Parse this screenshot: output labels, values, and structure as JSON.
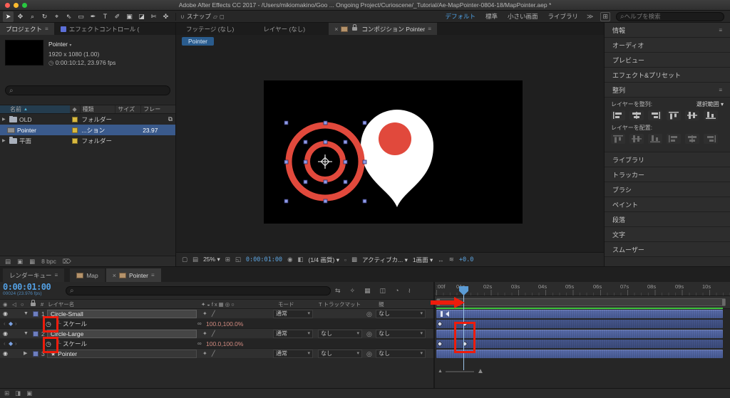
{
  "colors": {
    "annotation_red": "#ee1c0c",
    "accent_blue": "#4fa3e8",
    "selection_blue": "#3a5a8c",
    "layer_bar_blue": "#4a63a6",
    "target_red": "#e1493c",
    "label_yellow": "#d8b83f",
    "cache_green": "#3ec43e"
  },
  "titlebar": {
    "title": "Adobe After Effects CC 2017 - /Users/mikiomakino/Goo ... Ongoing Project/Curioscene/_Tutorial/Ae-MapPointer-0804-18/MapPointer.aep *"
  },
  "toolbar": {
    "tools": [
      {
        "name": "selection-tool",
        "glyph": "➤"
      },
      {
        "name": "hand-tool",
        "glyph": "✥"
      },
      {
        "name": "zoom-tool",
        "glyph": "⌕"
      },
      {
        "name": "rotation-tool",
        "glyph": "↻"
      },
      {
        "name": "camera-tool",
        "glyph": "⌖"
      },
      {
        "name": "pan-behind-tool",
        "glyph": "⇖"
      },
      {
        "name": "shape-tool",
        "glyph": "▭"
      },
      {
        "name": "pen-tool",
        "glyph": "✒"
      },
      {
        "name": "type-tool",
        "glyph": "T"
      },
      {
        "name": "brush-tool",
        "glyph": "✐"
      },
      {
        "name": "clone-stamp-tool",
        "glyph": "▣"
      },
      {
        "name": "eraser-tool",
        "glyph": "◪"
      },
      {
        "name": "roto-brush-tool",
        "glyph": "✄"
      },
      {
        "name": "puppet-pin-tool",
        "glyph": "✜"
      }
    ],
    "snap_label": "スナップ",
    "workspaces": [
      "デフォルト",
      "標準",
      "小さい画面",
      "ライブラリ"
    ],
    "overflow": "≫",
    "search_placeholder": "ヘルプを検索"
  },
  "project": {
    "tab_project": "プロジェクト",
    "tab_effect_controls": "エフェクトコントロール (",
    "comp_name": "Pointer",
    "comp_size": "1920 x 1080 (1.00)",
    "comp_duration": "0:00:10:12, 23.976 fps",
    "columns": {
      "name": "名前",
      "type": "種類",
      "size": "サイズ",
      "fps": "フレー"
    },
    "rows": [
      {
        "name": "OLD",
        "type": "フォルダー",
        "fps": ""
      },
      {
        "name": "Pointer",
        "type": "...ション",
        "fps": "23.97"
      },
      {
        "name": "平面",
        "type": "フォルダー",
        "fps": ""
      }
    ],
    "bpc": "8 bpc"
  },
  "comp": {
    "tab_footage": "フッテージ (なし)",
    "tab_layer": "レイヤー (なし)",
    "tab_comp": "コンポジション Pointer",
    "nav_tab": "Pointer",
    "footer": {
      "zoom": "25%",
      "timecode": "0:00:01:00",
      "quality": "(1/4 画質)",
      "view": "アクティブカ...",
      "layout": "1画面",
      "exposure": "+0.0"
    },
    "footer_icons": [
      {
        "name": "always-preview",
        "glyph": "▢"
      },
      {
        "name": "main-monitor",
        "glyph": "▤"
      },
      {
        "name": "grid-guides",
        "glyph": "⊞"
      },
      {
        "name": "mask-visibility",
        "glyph": "◱"
      },
      {
        "name": "snapshot",
        "glyph": "◉"
      },
      {
        "name": "show-channel",
        "glyph": "◧"
      },
      {
        "name": "region-of-interest",
        "glyph": "▫"
      },
      {
        "name": "transparency-grid",
        "glyph": "▩"
      },
      {
        "name": "pixel-aspect",
        "glyph": "↔"
      },
      {
        "name": "fast-previews",
        "glyph": "≋"
      }
    ]
  },
  "sidebar": {
    "items": [
      "情報",
      "オーディオ",
      "プレビュー",
      "エフェクト&プリセット",
      "整列",
      "ライブラリ",
      "トラッカー",
      "ブラシ",
      "ペイント",
      "段落",
      "文字",
      "スムーザー"
    ],
    "align": {
      "align_label": "レイヤーを整列:",
      "align_value": "選択範囲",
      "distribute_label": "レイヤーを配置:"
    }
  },
  "timeline": {
    "tab_render_queue": "レンダーキュー",
    "tab_map": "Map",
    "tab_pointer": "Pointer",
    "timecode": "0:00:01:00",
    "frame_info": "00024 (23.976 fps)",
    "columns": {
      "layer_name": "レイヤー名",
      "mode": "モード",
      "matte": "T トラックマット",
      "parent": "親"
    },
    "topbar_icons": [
      {
        "name": "comp-mini-flowchart",
        "glyph": "⇆"
      },
      {
        "name": "draft-3d",
        "glyph": "✧"
      },
      {
        "name": "hide-shy-layers",
        "glyph": "▦"
      },
      {
        "name": "frame-blend",
        "glyph": "◫"
      },
      {
        "name": "motion-blur",
        "glyph": "◔"
      },
      {
        "name": "graph-editor",
        "glyph": "≀"
      }
    ],
    "switch_header": "✦◒fx▦◎○",
    "layers": [
      {
        "num": "1",
        "name": "Circle-Small",
        "mode": "通常",
        "matte": "",
        "parent": "なし"
      },
      {
        "num": "2",
        "name": "Circle-Large",
        "mode": "通常",
        "matte": "なし",
        "parent": "なし"
      },
      {
        "num": "3",
        "name": "Pointer",
        "mode": "通常",
        "matte": "なし",
        "parent": "なし"
      }
    ],
    "property_name": "スケール",
    "property_value": "100.0,100.0%",
    "ruler_labels": [
      ":00f",
      "01s",
      "02s",
      "03s",
      "04s",
      "05s",
      "06s",
      "07s",
      "08s",
      "09s",
      "10s"
    ]
  },
  "statusbar_icons": [
    {
      "name": "toggle-switches-pane",
      "glyph": "⊞"
    },
    {
      "name": "toggle-transfer-pane",
      "glyph": "◨"
    },
    {
      "name": "toggle-inout-pane",
      "glyph": "▣"
    }
  ],
  "icons": {
    "menu": "≡",
    "search": "⌕",
    "caret": "▾",
    "twirl_open": "▼",
    "twirl_closed": "▶",
    "eye": "◉",
    "audio": "◁",
    "solo": "○",
    "star": "★",
    "stopwatch": "◷",
    "keyframe": "◆",
    "pickwhip": "◎",
    "link": "∞",
    "hash": "#",
    "close": "×",
    "sort": "▲",
    "snap_magnet": "∪",
    "branch": "└",
    "used": "⧉",
    "trash": "⌦",
    "layer_switches": "✦ ╱",
    "nav_prev": "‹",
    "nav_next": "›",
    "zoom_small": "▲",
    "zoom_big": "▲"
  }
}
